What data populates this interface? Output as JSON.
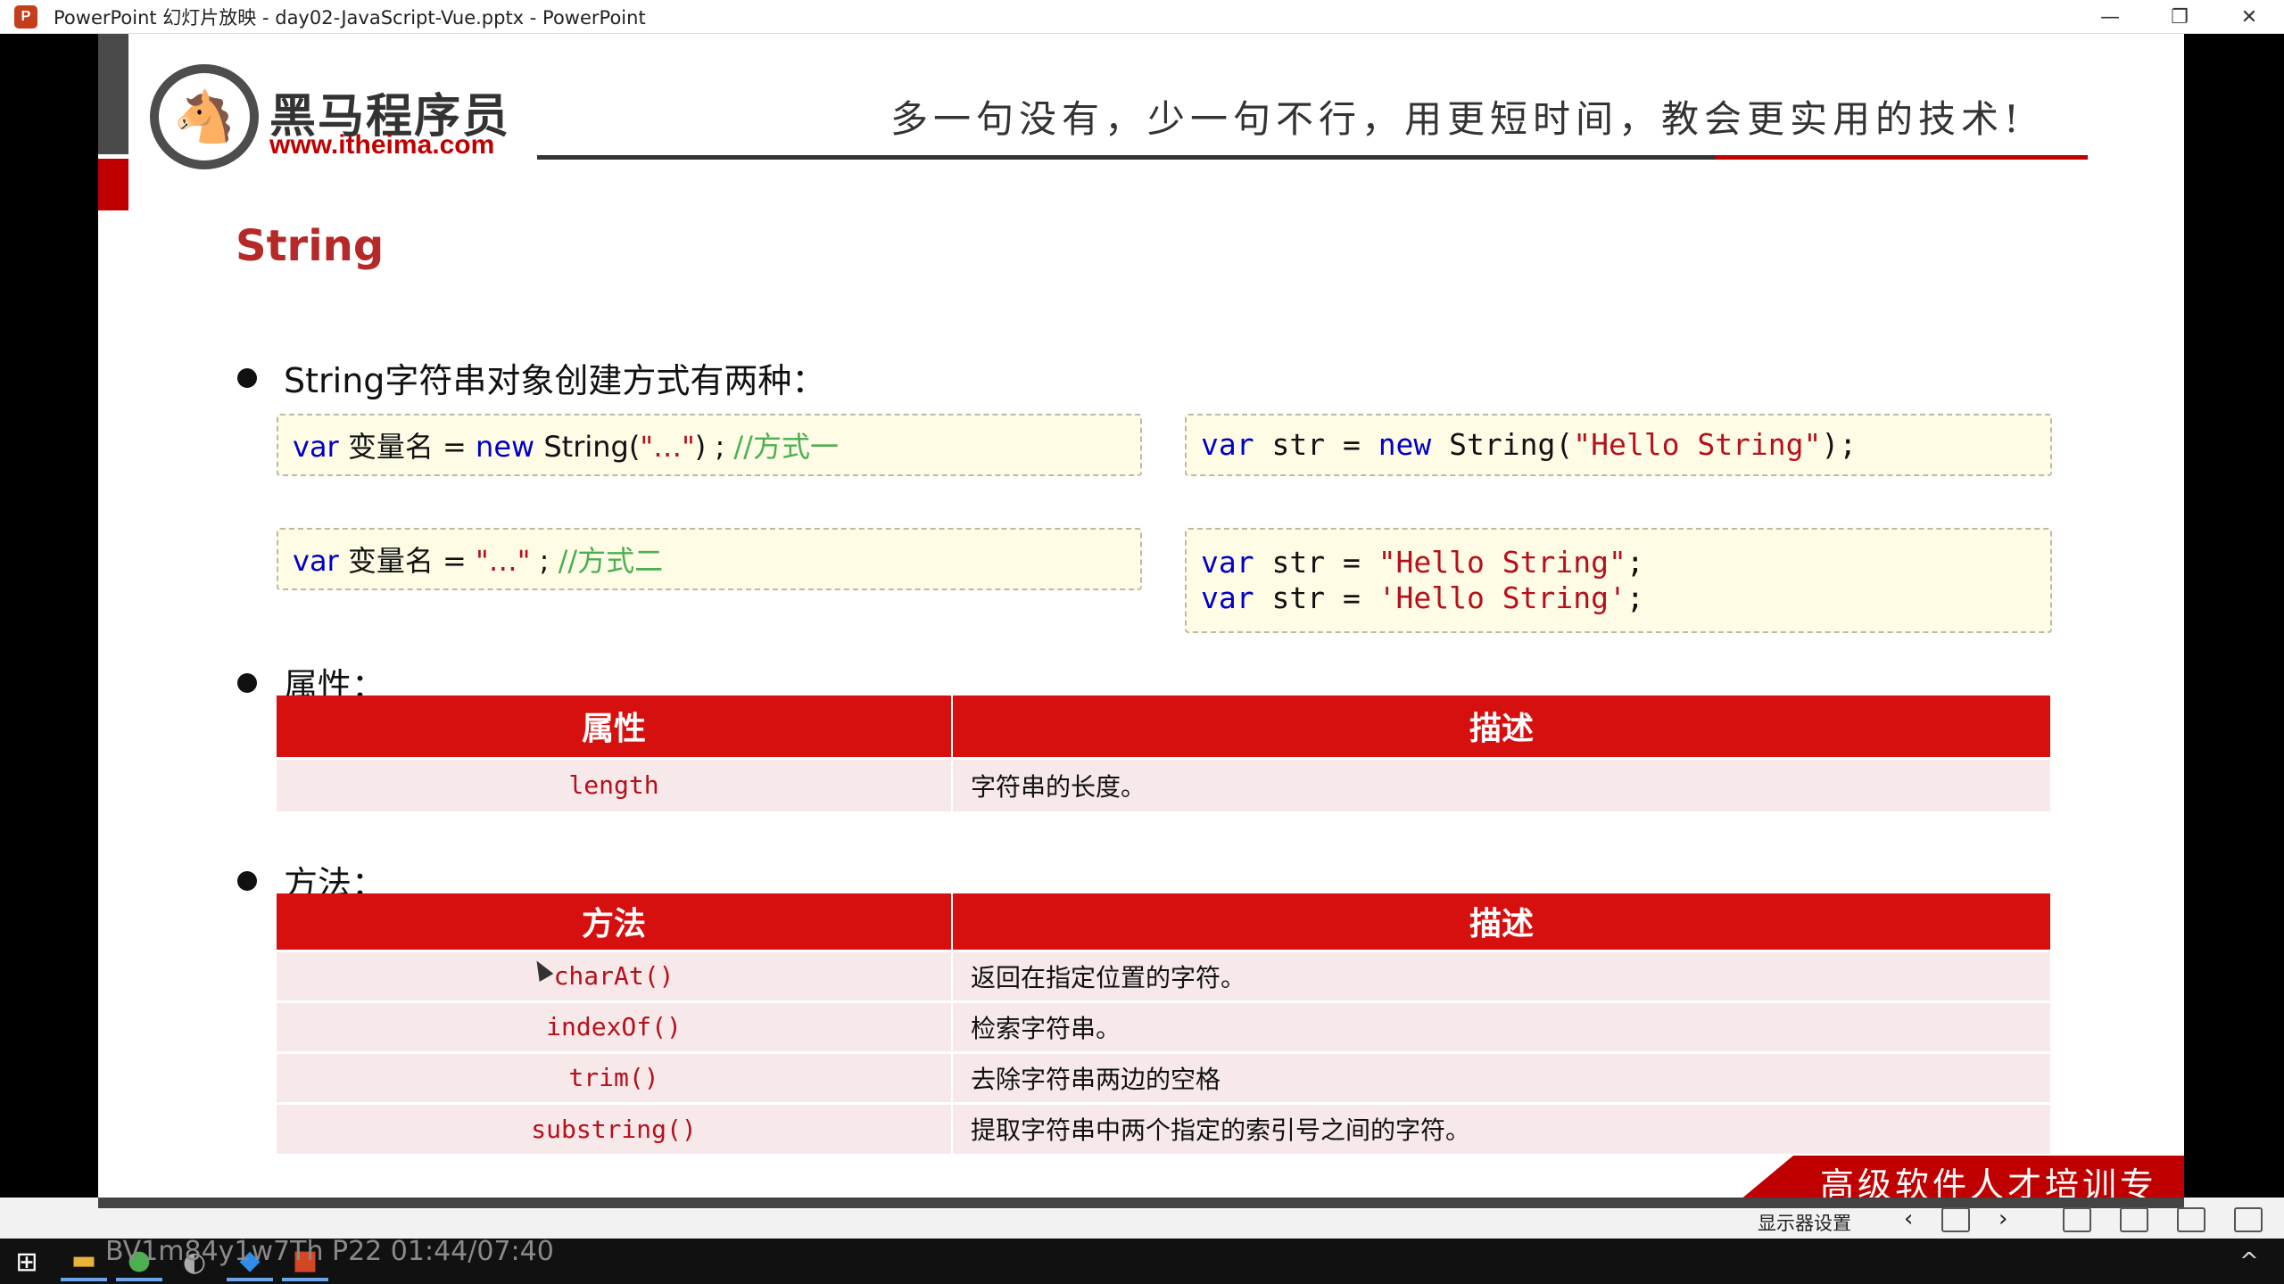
{
  "window": {
    "title": "PowerPoint 幻灯片放映  -  day02-JavaScript-Vue.pptx - PowerPoint",
    "app_icon": "P",
    "minimize": "—",
    "maximize": "❐",
    "close": "✕"
  },
  "header": {
    "logo_mark": "🐴",
    "logo_name": "黑马程序员",
    "logo_url": "www.itheima.com",
    "slogan": "多一句没有，少一句不行，用更短时间，教会更实用的技术!"
  },
  "slide": {
    "title": "String",
    "bullets": {
      "create": "String字符串对象创建方式有两种：",
      "properties": "属性：",
      "methods": "方法："
    },
    "code": {
      "way1": {
        "kw1": "var",
        "p1": " 变量名 = ",
        "kw2": "new",
        "p2": " String(",
        "s1": "\"…\"",
        "p3": ") ; ",
        "c1": "//方式一"
      },
      "example1": {
        "kw1": "var",
        "p1": " str = ",
        "kw2": "new",
        "p2": " String(",
        "s1": "\"Hello String\"",
        "p3": ");"
      },
      "way2": {
        "kw1": "var",
        "p1": " 变量名 = ",
        "s1": "\"…\"",
        "p2": " ; ",
        "c1": "//方式二"
      },
      "example2": {
        "line1": {
          "kw1": "var",
          "p1": " str = ",
          "s1": "\"Hello String\"",
          "p2": ";"
        },
        "line2": {
          "kw1": "var",
          "p1": " str = ",
          "s1": "'Hello String'",
          "p2": ";"
        }
      }
    },
    "property_table": {
      "headers": [
        "属性",
        "描述"
      ],
      "rows": [
        [
          "length",
          "字符串的长度。"
        ]
      ]
    },
    "method_table": {
      "headers": [
        "方法",
        "描述"
      ],
      "rows": [
        [
          "charAt()",
          "返回在指定位置的字符。"
        ],
        [
          "indexOf()",
          "检索字符串。"
        ],
        [
          "trim()",
          "去除字符串两边的空格"
        ],
        [
          "substring()",
          "提取字符串中两个指定的索引号之间的字符。"
        ]
      ]
    },
    "footer_slogan": "高级软件人才培训专家"
  },
  "presenter_bar": {
    "display_settings": "显示器设置",
    "prev": "‹",
    "next": "›"
  },
  "taskbar": {
    "watermark": "BV1m84y1w7Th P22 01:44/07:40",
    "start_icon": "⊞",
    "tray_arrow": "^"
  }
}
